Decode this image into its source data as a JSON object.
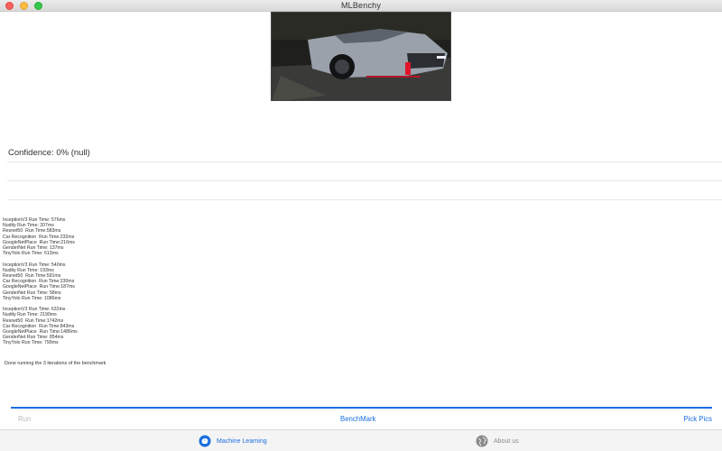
{
  "window": {
    "title": "MLBenchy"
  },
  "photo": {
    "icon": "car-photo"
  },
  "result": {
    "confidence": "Confidence: 0% (null)"
  },
  "log": {
    "iterations": [
      [
        "InceptionV3 Run Time: 576ms",
        "Nudity Run Time: 207ms",
        "Resnet50  Run Time:583ms",
        "Car Recognition  Run Time:232ms",
        "GoogleNetPlace  Run Time:216ms",
        "GenderNet Run Time: 137ms",
        "TinyYolo Run Time: 613ms"
      ],
      [
        "InceptionV3 Run Time: 540ms",
        "Nudity Run Time: 193ms",
        "Resnet50  Run Time:591ms",
        "Car Recognition  Run Time:230ms",
        "GoogleNetPlace  Run Time:187ms",
        "GenderNet Run Time: 58ms",
        "TinyYolo Run Time: 1086ms"
      ],
      [
        "InceptionV3 Run Time: 632ms",
        "Nudity Run Time: 2190ms",
        "Resnet50  Run Time:1742ms",
        "Car Recognition  Run Time:843ms",
        "GoogleNetPlace  Run Time:1486ms",
        "GenderNet Run Time: 854ms",
        "TinyYolo Run Time: 799ms"
      ]
    ],
    "done": "Done running the 3 iterations of the benchmark"
  },
  "progress": {
    "value": 1.0
  },
  "actions": {
    "run": "Run",
    "benchmark": "BenchMark",
    "pick": "Pick Pics"
  },
  "tabs": {
    "machine_learning": {
      "label": "Machine Learning",
      "icon": "brain-icon"
    },
    "about": {
      "label": "About us",
      "icon": "globe-icon"
    }
  },
  "colors": {
    "accent": "#1b6fe0",
    "disabled": "#b8b8b8"
  }
}
